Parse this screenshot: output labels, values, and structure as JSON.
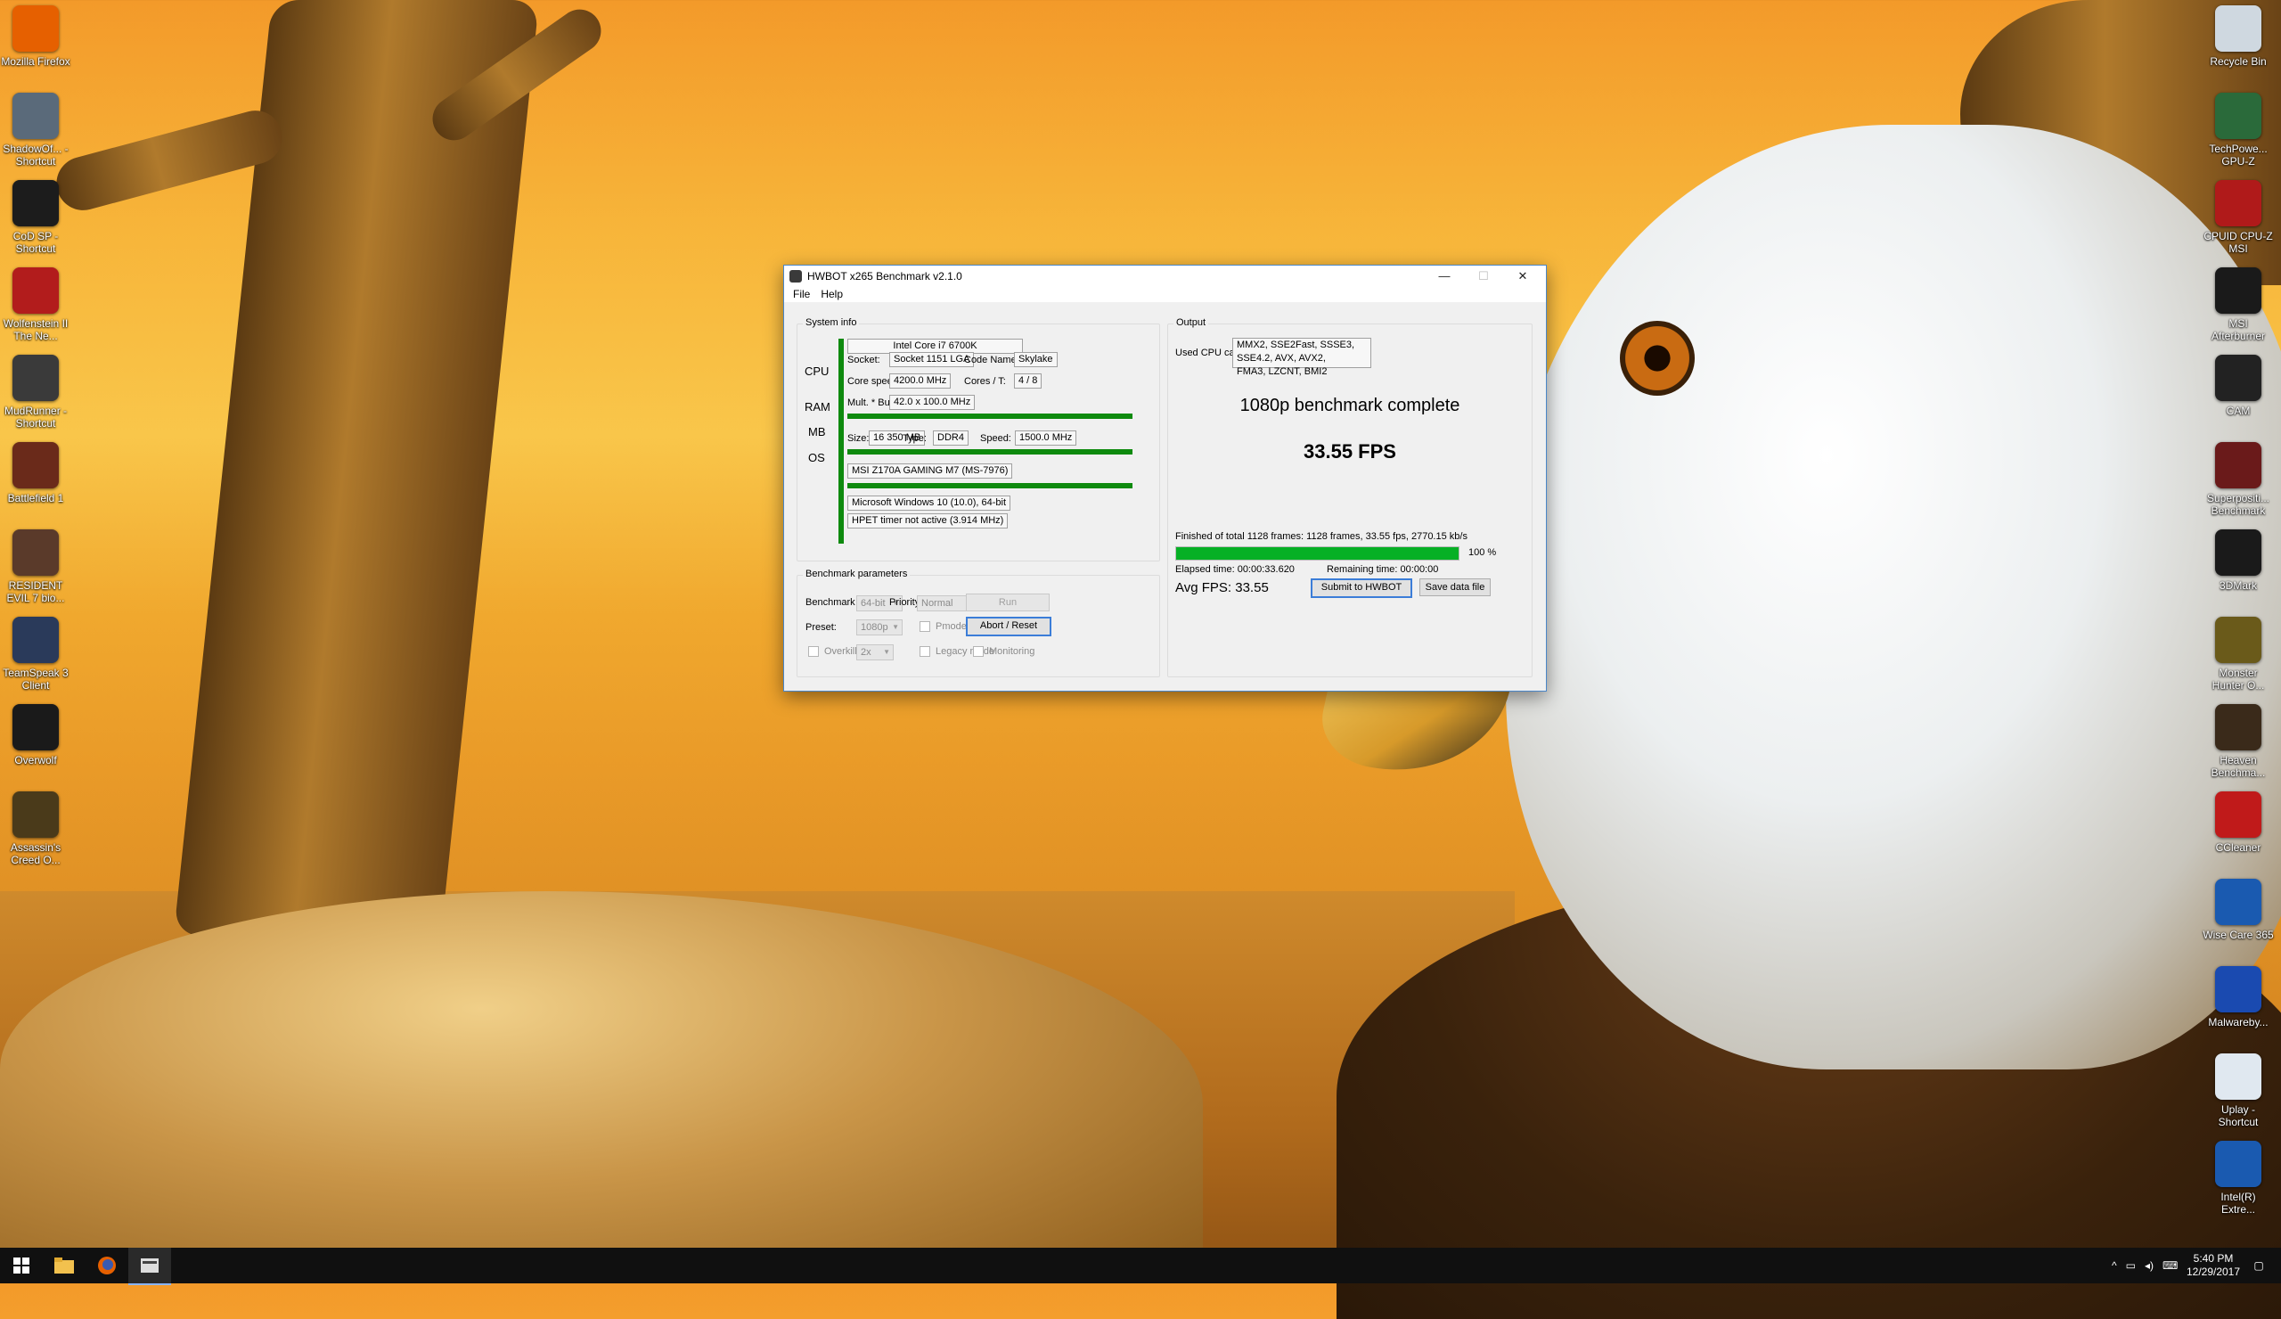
{
  "desktop": {
    "left_icons": [
      {
        "label": "Mozilla Firefox",
        "icon": "firefox-icon",
        "color": "#e66000"
      },
      {
        "label": "ShadowOf... - Shortcut",
        "icon": "shadow-of-war-icon",
        "color": "#5a6a7a"
      },
      {
        "label": "CoD SP - Shortcut",
        "icon": "cod-icon",
        "color": "#1c1c1c"
      },
      {
        "label": "Wolfenstein II The Ne...",
        "icon": "wolfenstein-icon",
        "color": "#b21c1c"
      },
      {
        "label": "MudRunner - Shortcut",
        "icon": "mudrunner-icon",
        "color": "#3a3a3a"
      },
      {
        "label": "Battlefield 1",
        "icon": "battlefield-icon",
        "color": "#6a2a1a"
      },
      {
        "label": "RESIDENT EVIL 7 bio...",
        "icon": "resident-evil-icon",
        "color": "#5a3a2a"
      },
      {
        "label": "TeamSpeak 3 Client",
        "icon": "teamspeak-icon",
        "color": "#2a3a5a"
      },
      {
        "label": "Overwolf",
        "icon": "overwolf-icon",
        "color": "#1a1a1a"
      },
      {
        "label": "Assassin's Creed O...",
        "icon": "assassins-creed-icon",
        "color": "#4a3a1a"
      }
    ],
    "right_icons": [
      {
        "label": "Recycle Bin",
        "icon": "recycle-bin-icon",
        "color": "#cfd8e0"
      },
      {
        "label": "TechPowe... GPU-Z",
        "icon": "gpu-z-icon",
        "color": "#2a6a3a"
      },
      {
        "label": "CPUID CPU-Z MSI",
        "icon": "cpu-z-icon",
        "color": "#b01a1a"
      },
      {
        "label": "MSI Afterburner",
        "icon": "afterburner-icon",
        "color": "#1a1a1a"
      },
      {
        "label": "CAM",
        "icon": "cam-icon",
        "color": "#222222"
      },
      {
        "label": "Superpositi... Benchmark",
        "icon": "superposition-icon",
        "color": "#6a1a1a"
      },
      {
        "label": "3DMark",
        "icon": "3dmark-icon",
        "color": "#1a1a1a"
      },
      {
        "label": "Monster Hunter O...",
        "icon": "monster-hunter-icon",
        "color": "#6a5a1a"
      },
      {
        "label": "Heaven Benchma...",
        "icon": "heaven-icon",
        "color": "#3a2a1a"
      },
      {
        "label": "CCleaner",
        "icon": "ccleaner-icon",
        "color": "#c01a1a"
      },
      {
        "label": "Wise Care 365",
        "icon": "wise-care-icon",
        "color": "#1a5ab0"
      },
      {
        "label": "Malwareby...",
        "icon": "malwarebytes-icon",
        "color": "#1a4ab0"
      },
      {
        "label": "Uplay - Shortcut",
        "icon": "uplay-icon",
        "color": "#e0e8f0"
      },
      {
        "label": "Intel(R) Extre...",
        "icon": "intel-xtu-icon",
        "color": "#1a5ab0"
      }
    ]
  },
  "window": {
    "title": "HWBOT x265 Benchmark v2.1.0",
    "menu": [
      "File",
      "Help"
    ],
    "controls": {
      "minimize": "—",
      "maximize": "☐",
      "close": "✕"
    }
  },
  "system_info": {
    "title": "System info",
    "cpu": {
      "section": "CPU",
      "name": "Intel Core i7 6700K",
      "socket_label": "Socket:",
      "socket": "Socket 1151 LGA",
      "codename_label": "Code Name:",
      "codename": "Skylake",
      "speed_label": "Core speed:",
      "speed": "4200.0 MHz",
      "cores_label": "Cores / T:",
      "cores": "4 / 8",
      "mult_label": "Mult. * Bus:",
      "mult": "42.0 x 100.0 MHz"
    },
    "ram": {
      "section": "RAM",
      "size_label": "Size:",
      "size": "16 350 MB",
      "type_label": "Type:",
      "type": "DDR4",
      "speed_label": "Speed:",
      "speed": "1500.0 MHz"
    },
    "mb": {
      "section": "MB",
      "name": "MSI Z170A GAMING M7 (MS-7976)"
    },
    "os": {
      "section": "OS",
      "name": "Microsoft Windows 10 (10.0), 64-bit",
      "timer": "HPET timer not active (3.914 MHz)"
    }
  },
  "params": {
    "title": "Benchmark parameters",
    "type_label": "Benchmark type:",
    "type": "64-bit",
    "priority_label": "Priority:",
    "priority": "Normal",
    "preset_label": "Preset:",
    "preset": "1080p",
    "overkill_label": "Overkill mode",
    "overkill_value": "2x",
    "pmode_label": "Pmode",
    "legacy_label": "Legacy mode",
    "monitoring_label": "Monitoring",
    "run_label": "Run",
    "abort_label": "Abort / Reset"
  },
  "output": {
    "title": "Output",
    "capabilities_label": "Used CPU capabilities:",
    "capabilities_line1": "MMX2, SSE2Fast, SSSE3, SSE4.2, AVX, AVX2,",
    "capabilities_line2": "FMA3, LZCNT, BMI2",
    "status": "1080p benchmark complete",
    "fps": "33.55 FPS",
    "finished_text": "Finished of total 1128 frames: 1128 frames, 33.55 fps,  2770.15 kb/s",
    "progress": 1.0,
    "progress_text": "100 %",
    "elapsed": "Elapsed time: 00:00:33.620",
    "remaining": "Remaining time: 00:00:00",
    "avg_fps": "Avg FPS: 33.55",
    "submit_label": "Submit to HWBOT",
    "save_label": "Save data file"
  },
  "taskbar": {
    "time": "5:40 PM",
    "date": "12/29/2017",
    "apps": [
      "windows-start-icon",
      "file-explorer-icon",
      "firefox-icon",
      "hwbot-icon"
    ]
  },
  "colors": {
    "accent": "#0e8a0e",
    "progress": "#06b025",
    "window_border": "#4a86c8"
  }
}
